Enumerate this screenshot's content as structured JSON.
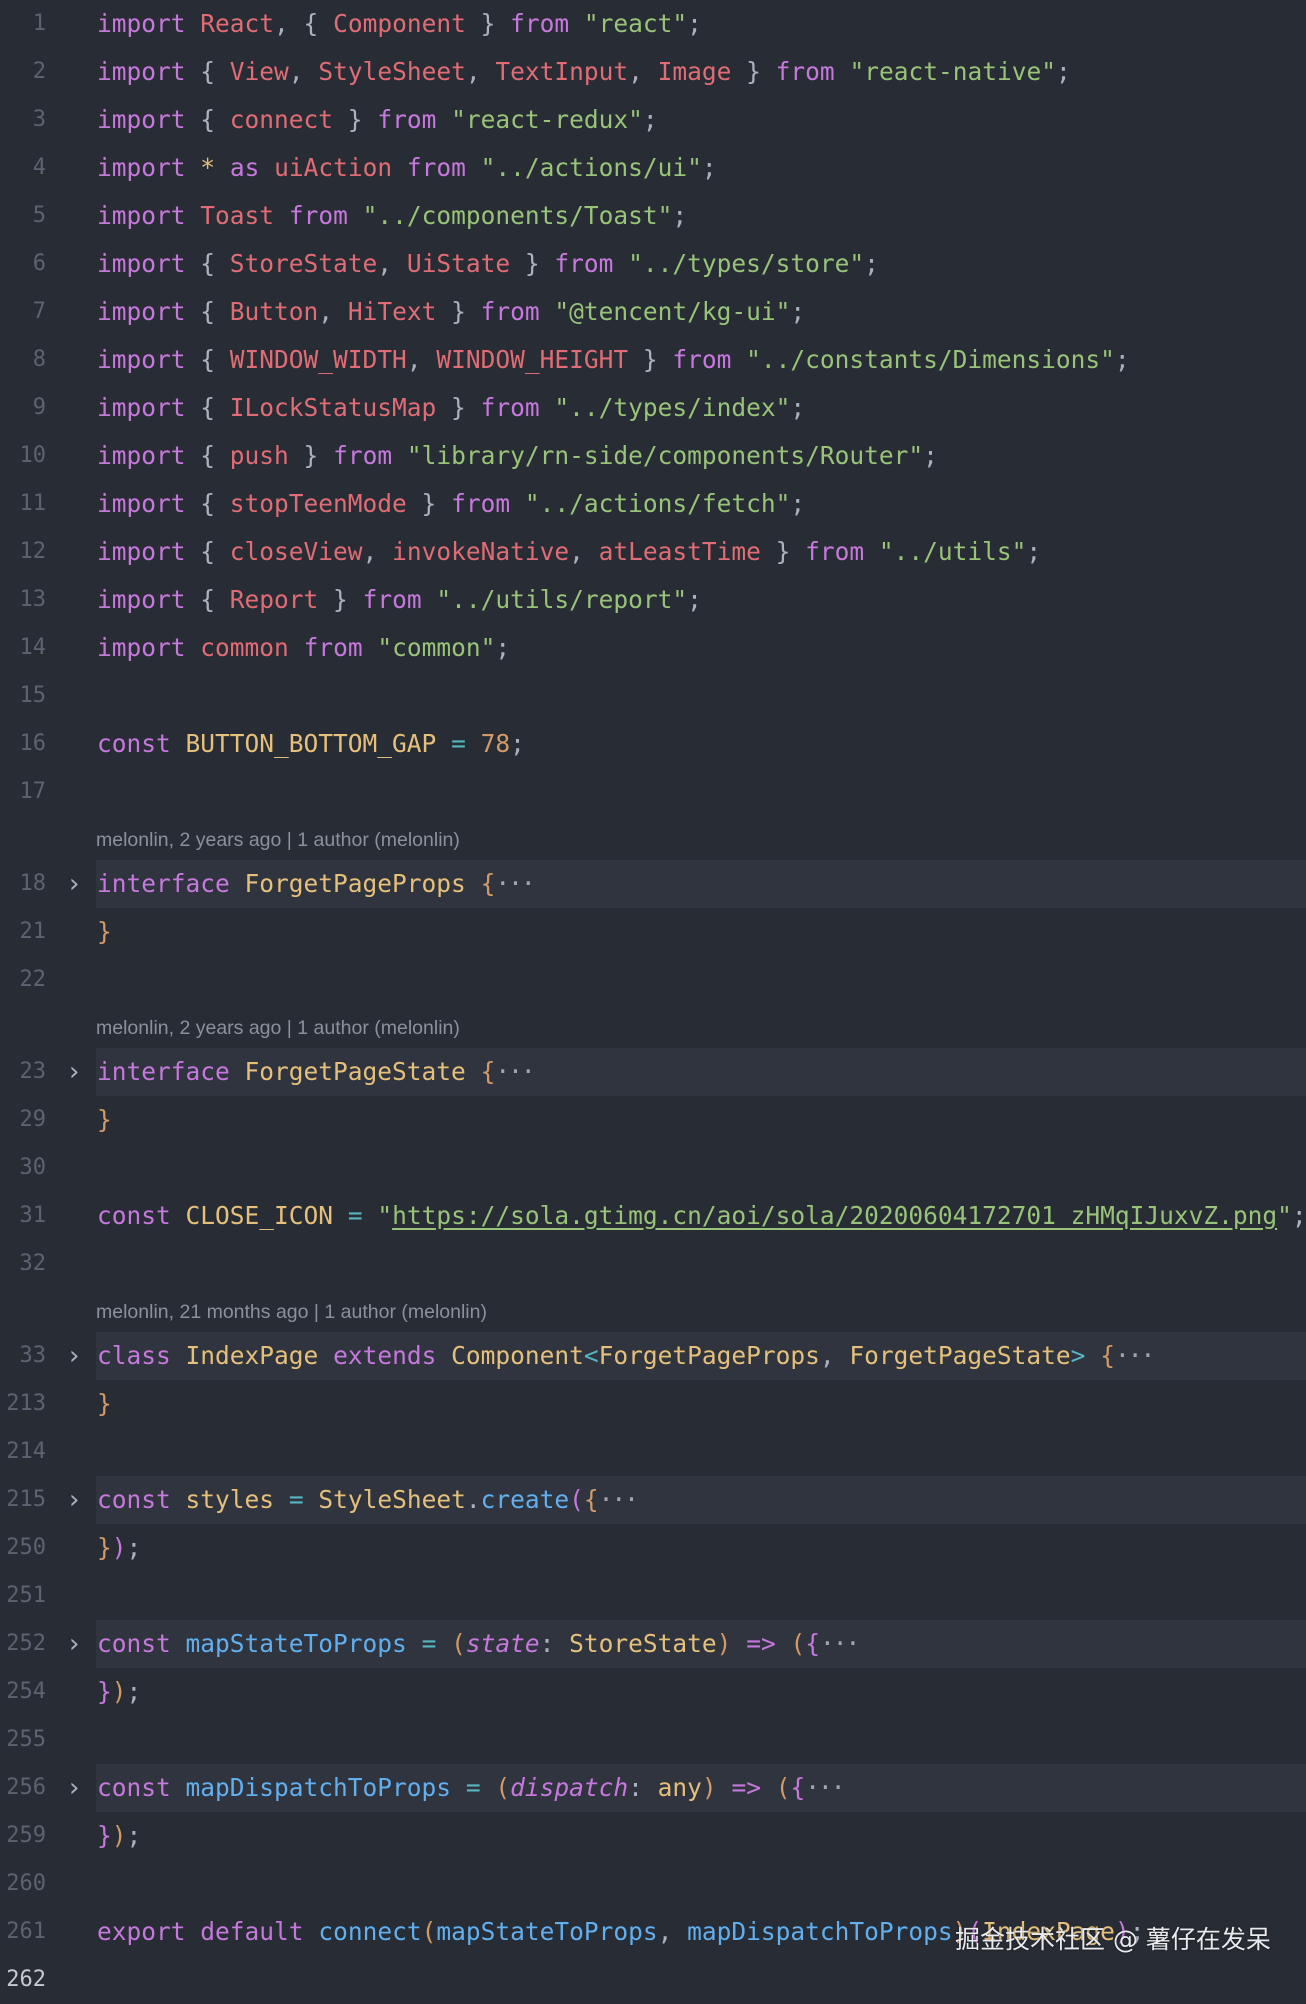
{
  "editor": {
    "active_line": "262",
    "blame": [
      {
        "author": "melonlin",
        "time": "2 years ago",
        "summary": "1 author (melonlin)"
      },
      {
        "author": "melonlin",
        "time": "2 years ago",
        "summary": "1 author (melonlin)"
      },
      {
        "author": "melonlin",
        "time": "21 months ago",
        "summary": "1 author (melonlin)"
      }
    ],
    "lines": [
      {
        "num": "1",
        "folded": false,
        "tokens": [
          [
            "k",
            "import"
          ],
          [
            "p",
            " "
          ],
          [
            "v",
            "React"
          ],
          [
            "p",
            ", { "
          ],
          [
            "v",
            "Component"
          ],
          [
            "p",
            " } "
          ],
          [
            "k",
            "from"
          ],
          [
            "p",
            " "
          ],
          [
            "s",
            "\"react\""
          ],
          [
            "p",
            ";"
          ]
        ]
      },
      {
        "num": "2",
        "folded": false,
        "tokens": [
          [
            "k",
            "import"
          ],
          [
            "p",
            " { "
          ],
          [
            "v",
            "View"
          ],
          [
            "p",
            ", "
          ],
          [
            "v",
            "StyleSheet"
          ],
          [
            "p",
            ", "
          ],
          [
            "v",
            "TextInput"
          ],
          [
            "p",
            ", "
          ],
          [
            "v",
            "Image"
          ],
          [
            "p",
            " } "
          ],
          [
            "k",
            "from"
          ],
          [
            "p",
            " "
          ],
          [
            "s",
            "\"react-native\""
          ],
          [
            "p",
            ";"
          ]
        ]
      },
      {
        "num": "3",
        "folded": false,
        "tokens": [
          [
            "k",
            "import"
          ],
          [
            "p",
            " { "
          ],
          [
            "v",
            "connect"
          ],
          [
            "p",
            " } "
          ],
          [
            "k",
            "from"
          ],
          [
            "p",
            " "
          ],
          [
            "s",
            "\"react-redux\""
          ],
          [
            "p",
            ";"
          ]
        ]
      },
      {
        "num": "4",
        "folded": false,
        "tokens": [
          [
            "k",
            "import"
          ],
          [
            "p",
            " "
          ],
          [
            "c",
            "*"
          ],
          [
            "p",
            " "
          ],
          [
            "k",
            "as"
          ],
          [
            "p",
            " "
          ],
          [
            "v",
            "uiAction"
          ],
          [
            "p",
            " "
          ],
          [
            "k",
            "from"
          ],
          [
            "p",
            " "
          ],
          [
            "s",
            "\"../actions/ui\""
          ],
          [
            "p",
            ";"
          ]
        ]
      },
      {
        "num": "5",
        "folded": false,
        "tokens": [
          [
            "k",
            "import"
          ],
          [
            "p",
            " "
          ],
          [
            "v",
            "Toast"
          ],
          [
            "p",
            " "
          ],
          [
            "k",
            "from"
          ],
          [
            "p",
            " "
          ],
          [
            "s",
            "\"../components/Toast\""
          ],
          [
            "p",
            ";"
          ]
        ]
      },
      {
        "num": "6",
        "folded": false,
        "tokens": [
          [
            "k",
            "import"
          ],
          [
            "p",
            " { "
          ],
          [
            "v",
            "StoreState"
          ],
          [
            "p",
            ", "
          ],
          [
            "v",
            "UiState"
          ],
          [
            "p",
            " } "
          ],
          [
            "k",
            "from"
          ],
          [
            "p",
            " "
          ],
          [
            "s",
            "\"../types/store\""
          ],
          [
            "p",
            ";"
          ]
        ]
      },
      {
        "num": "7",
        "folded": false,
        "tokens": [
          [
            "k",
            "import"
          ],
          [
            "p",
            " { "
          ],
          [
            "v",
            "Button"
          ],
          [
            "p",
            ", "
          ],
          [
            "v",
            "HiText"
          ],
          [
            "p",
            " } "
          ],
          [
            "k",
            "from"
          ],
          [
            "p",
            " "
          ],
          [
            "s",
            "\"@tencent/kg-ui\""
          ],
          [
            "p",
            ";"
          ]
        ]
      },
      {
        "num": "8",
        "folded": false,
        "tokens": [
          [
            "k",
            "import"
          ],
          [
            "p",
            " { "
          ],
          [
            "v",
            "WINDOW_WIDTH"
          ],
          [
            "p",
            ", "
          ],
          [
            "v",
            "WINDOW_HEIGHT"
          ],
          [
            "p",
            " } "
          ],
          [
            "k",
            "from"
          ],
          [
            "p",
            " "
          ],
          [
            "s",
            "\"../constants/Dimensions\""
          ],
          [
            "p",
            ";"
          ]
        ]
      },
      {
        "num": "9",
        "folded": false,
        "tokens": [
          [
            "k",
            "import"
          ],
          [
            "p",
            " { "
          ],
          [
            "v",
            "ILockStatusMap"
          ],
          [
            "p",
            " } "
          ],
          [
            "k",
            "from"
          ],
          [
            "p",
            " "
          ],
          [
            "s",
            "\"../types/index\""
          ],
          [
            "p",
            ";"
          ]
        ]
      },
      {
        "num": "10",
        "folded": false,
        "tokens": [
          [
            "k",
            "import"
          ],
          [
            "p",
            " { "
          ],
          [
            "v",
            "push"
          ],
          [
            "p",
            " } "
          ],
          [
            "k",
            "from"
          ],
          [
            "p",
            " "
          ],
          [
            "s",
            "\"library/rn-side/components/Router\""
          ],
          [
            "p",
            ";"
          ]
        ]
      },
      {
        "num": "11",
        "folded": false,
        "tokens": [
          [
            "k",
            "import"
          ],
          [
            "p",
            " { "
          ],
          [
            "v",
            "stopTeenMode"
          ],
          [
            "p",
            " } "
          ],
          [
            "k",
            "from"
          ],
          [
            "p",
            " "
          ],
          [
            "s",
            "\"../actions/fetch\""
          ],
          [
            "p",
            ";"
          ]
        ]
      },
      {
        "num": "12",
        "folded": false,
        "tokens": [
          [
            "k",
            "import"
          ],
          [
            "p",
            " { "
          ],
          [
            "v",
            "closeView"
          ],
          [
            "p",
            ", "
          ],
          [
            "v",
            "invokeNative"
          ],
          [
            "p",
            ", "
          ],
          [
            "v",
            "atLeastTime"
          ],
          [
            "p",
            " } "
          ],
          [
            "k",
            "from"
          ],
          [
            "p",
            " "
          ],
          [
            "s",
            "\"../utils\""
          ],
          [
            "p",
            ";"
          ]
        ]
      },
      {
        "num": "13",
        "folded": false,
        "tokens": [
          [
            "k",
            "import"
          ],
          [
            "p",
            " { "
          ],
          [
            "v",
            "Report"
          ],
          [
            "p",
            " } "
          ],
          [
            "k",
            "from"
          ],
          [
            "p",
            " "
          ],
          [
            "s",
            "\"../utils/report\""
          ],
          [
            "p",
            ";"
          ]
        ]
      },
      {
        "num": "14",
        "folded": false,
        "tokens": [
          [
            "k",
            "import"
          ],
          [
            "p",
            " "
          ],
          [
            "v",
            "common"
          ],
          [
            "p",
            " "
          ],
          [
            "k",
            "from"
          ],
          [
            "p",
            " "
          ],
          [
            "s",
            "\"common\""
          ],
          [
            "p",
            ";"
          ]
        ]
      },
      {
        "num": "15",
        "folded": false,
        "tokens": []
      },
      {
        "num": "16",
        "folded": false,
        "tokens": [
          [
            "k",
            "const"
          ],
          [
            "p",
            " "
          ],
          [
            "c",
            "BUTTON_BOTTOM_GAP"
          ],
          [
            "p",
            " "
          ],
          [
            "o",
            "="
          ],
          [
            "p",
            " "
          ],
          [
            "n",
            "78"
          ],
          [
            "p",
            ";"
          ]
        ]
      },
      {
        "num": "17",
        "folded": false,
        "tokens": []
      },
      {
        "num": "18",
        "folded": true,
        "tokens": [
          [
            "k",
            "interface"
          ],
          [
            "p",
            " "
          ],
          [
            "c",
            "ForgetPageProps"
          ],
          [
            "p",
            " "
          ],
          [
            "n",
            "{"
          ],
          [
            "e",
            "···"
          ]
        ]
      },
      {
        "num": "21",
        "folded": false,
        "tokens": [
          [
            "n",
            "}"
          ]
        ]
      },
      {
        "num": "22",
        "folded": false,
        "tokens": []
      },
      {
        "num": "23",
        "folded": true,
        "tokens": [
          [
            "k",
            "interface"
          ],
          [
            "p",
            " "
          ],
          [
            "c",
            "ForgetPageState"
          ],
          [
            "p",
            " "
          ],
          [
            "n",
            "{"
          ],
          [
            "e",
            "···"
          ]
        ]
      },
      {
        "num": "29",
        "folded": false,
        "tokens": [
          [
            "n",
            "}"
          ]
        ]
      },
      {
        "num": "30",
        "folded": false,
        "tokens": []
      },
      {
        "num": "31",
        "folded": false,
        "tokens": [
          [
            "k",
            "const"
          ],
          [
            "p",
            " "
          ],
          [
            "c",
            "CLOSE_ICON"
          ],
          [
            "p",
            " "
          ],
          [
            "o",
            "="
          ],
          [
            "p",
            " "
          ],
          [
            "s",
            "\""
          ],
          [
            "u",
            "https://sola.gtimg.cn/aoi/sola/20200604172701_zHMqIJuxvZ.png"
          ],
          [
            "s",
            "\""
          ],
          [
            "p",
            ";"
          ]
        ]
      },
      {
        "num": "32",
        "folded": false,
        "tokens": []
      },
      {
        "num": "33",
        "folded": true,
        "tokens": [
          [
            "k",
            "class"
          ],
          [
            "p",
            " "
          ],
          [
            "c",
            "IndexPage"
          ],
          [
            "p",
            " "
          ],
          [
            "k",
            "extends"
          ],
          [
            "p",
            " "
          ],
          [
            "c",
            "Component"
          ],
          [
            "o",
            "<"
          ],
          [
            "c",
            "ForgetPageProps"
          ],
          [
            "p",
            ", "
          ],
          [
            "c",
            "ForgetPageState"
          ],
          [
            "o",
            ">"
          ],
          [
            "p",
            " "
          ],
          [
            "n",
            "{"
          ],
          [
            "e",
            "···"
          ]
        ]
      },
      {
        "num": "213",
        "folded": false,
        "tokens": [
          [
            "n",
            "}"
          ]
        ]
      },
      {
        "num": "214",
        "folded": false,
        "tokens": []
      },
      {
        "num": "215",
        "folded": true,
        "tokens": [
          [
            "k",
            "const"
          ],
          [
            "p",
            " "
          ],
          [
            "c",
            "styles"
          ],
          [
            "p",
            " "
          ],
          [
            "o",
            "="
          ],
          [
            "p",
            " "
          ],
          [
            "c",
            "StyleSheet"
          ],
          [
            "p",
            "."
          ],
          [
            "f",
            "create"
          ],
          [
            "k",
            "("
          ],
          [
            "n",
            "{"
          ],
          [
            "e",
            "···"
          ]
        ]
      },
      {
        "num": "250",
        "folded": false,
        "tokens": [
          [
            "n",
            "}"
          ],
          [
            "k",
            ")"
          ],
          [
            "p",
            ";"
          ]
        ]
      },
      {
        "num": "251",
        "folded": false,
        "tokens": []
      },
      {
        "num": "252",
        "folded": true,
        "tokens": [
          [
            "k",
            "const"
          ],
          [
            "p",
            " "
          ],
          [
            "f",
            "mapStateToProps"
          ],
          [
            "p",
            " "
          ],
          [
            "o",
            "="
          ],
          [
            "p",
            " "
          ],
          [
            "n",
            "("
          ],
          [
            "i",
            "state"
          ],
          [
            "p",
            ": "
          ],
          [
            "c",
            "StoreState"
          ],
          [
            "n",
            ")"
          ],
          [
            "p",
            " "
          ],
          [
            "k",
            "=>"
          ],
          [
            "p",
            " "
          ],
          [
            "n",
            "("
          ],
          [
            "k",
            "{"
          ],
          [
            "e",
            "···"
          ]
        ]
      },
      {
        "num": "254",
        "folded": false,
        "tokens": [
          [
            "k",
            "}"
          ],
          [
            "n",
            ")"
          ],
          [
            "p",
            ";"
          ]
        ]
      },
      {
        "num": "255",
        "folded": false,
        "tokens": []
      },
      {
        "num": "256",
        "folded": true,
        "tokens": [
          [
            "k",
            "const"
          ],
          [
            "p",
            " "
          ],
          [
            "f",
            "mapDispatchToProps"
          ],
          [
            "p",
            " "
          ],
          [
            "o",
            "="
          ],
          [
            "p",
            " "
          ],
          [
            "n",
            "("
          ],
          [
            "i",
            "dispatch"
          ],
          [
            "p",
            ": "
          ],
          [
            "c",
            "any"
          ],
          [
            "n",
            ")"
          ],
          [
            "p",
            " "
          ],
          [
            "k",
            "=>"
          ],
          [
            "p",
            " "
          ],
          [
            "n",
            "("
          ],
          [
            "k",
            "{"
          ],
          [
            "e",
            "···"
          ]
        ]
      },
      {
        "num": "259",
        "folded": false,
        "tokens": [
          [
            "k",
            "}"
          ],
          [
            "n",
            ")"
          ],
          [
            "p",
            ";"
          ]
        ]
      },
      {
        "num": "260",
        "folded": false,
        "tokens": []
      },
      {
        "num": "261",
        "folded": false,
        "tokens": [
          [
            "k",
            "export"
          ],
          [
            "p",
            " "
          ],
          [
            "k",
            "default"
          ],
          [
            "p",
            " "
          ],
          [
            "f",
            "connect"
          ],
          [
            "n",
            "("
          ],
          [
            "f",
            "mapStateToProps"
          ],
          [
            "p",
            ", "
          ],
          [
            "f",
            "mapDispatchToProps"
          ],
          [
            "n",
            ")"
          ],
          [
            "k",
            "("
          ],
          [
            "c",
            "IndexPage"
          ],
          [
            "k",
            ")"
          ],
          [
            "p",
            ";"
          ]
        ]
      },
      {
        "num": "262",
        "folded": false,
        "tokens": []
      }
    ]
  },
  "watermark": {
    "text": "掘金技术社区 @ 薯仔在发呆"
  }
}
